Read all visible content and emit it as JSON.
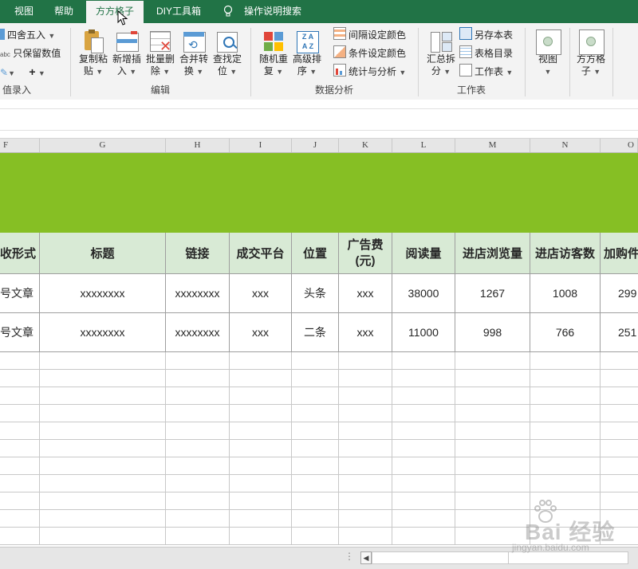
{
  "tabs": [
    {
      "label": "视图",
      "active": false
    },
    {
      "label": "帮助",
      "active": false
    },
    {
      "label": "方方格子",
      "active": true
    },
    {
      "label": "DIY工具箱",
      "active": false
    },
    {
      "label": "操作说明搜索",
      "active": false,
      "icon": "lightbulb-icon"
    }
  ],
  "ribbon": {
    "group_partial": {
      "items": [
        "四舍五入",
        "只保留数值",
        "+"
      ],
      "label": "值录入"
    },
    "group_edit": {
      "label": "编辑",
      "buttons": [
        {
          "line1": "复制粘",
          "line2": "贴",
          "icon": "copy-paste-icon"
        },
        {
          "line1": "新增插",
          "line2": "入",
          "icon": "insert-icon"
        },
        {
          "line1": "批量删",
          "line2": "除",
          "icon": "batch-delete-icon"
        },
        {
          "line1": "合并转",
          "line2": "换",
          "icon": "merge-convert-icon"
        },
        {
          "line1": "查找定",
          "line2": "位",
          "icon": "find-locate-icon"
        }
      ]
    },
    "group_analysis": {
      "label": "数据分析",
      "buttons": [
        {
          "line1": "随机重",
          "line2": "复",
          "icon": "random-repeat-icon"
        },
        {
          "line1": "高级排",
          "line2": "序",
          "icon": "advanced-sort-icon"
        }
      ],
      "small": [
        "间隔设定颜色",
        "条件设定颜色",
        "统计与分析"
      ]
    },
    "group_sheet": {
      "label": "工作表",
      "button": {
        "line1": "汇总拆",
        "line2": "分",
        "icon": "summary-split-icon"
      },
      "small": [
        "另存本表",
        "表格目录",
        "工作表"
      ]
    },
    "view_button": {
      "label": "视图",
      "icon": "view-icon"
    },
    "ffgz_button": {
      "line1": "方方格",
      "line2": "子",
      "icon": "ffgz-icon"
    }
  },
  "column_headers": [
    "F",
    "G",
    "H",
    "I",
    "J",
    "K",
    "L",
    "M",
    "N",
    "O"
  ],
  "table": {
    "headers": [
      "收形式",
      "标题",
      "链接",
      "成交平台",
      "位置",
      "广告费(元)",
      "阅读量",
      "进店浏览量",
      "进店访客数",
      "加购件"
    ],
    "header_k_line1": "广告费",
    "header_k_line2": "(元)",
    "rows": [
      [
        "号文章",
        "xxxxxxxx",
        "xxxxxxxx",
        "xxx",
        "头条",
        "xxx",
        "38000",
        "1267",
        "1008",
        "299"
      ],
      [
        "号文章",
        "xxxxxxxx",
        "xxxxxxxx",
        "xxx",
        "二条",
        "xxx",
        "11000",
        "998",
        "766",
        "251"
      ]
    ],
    "empty_rows": 11
  },
  "watermark": {
    "text": "Bai 经验",
    "url": "jingyan.baidu.com"
  },
  "colors": {
    "tab_bar": "#217346",
    "banner": "#86bf24",
    "header_fill": "#d8ead5"
  }
}
